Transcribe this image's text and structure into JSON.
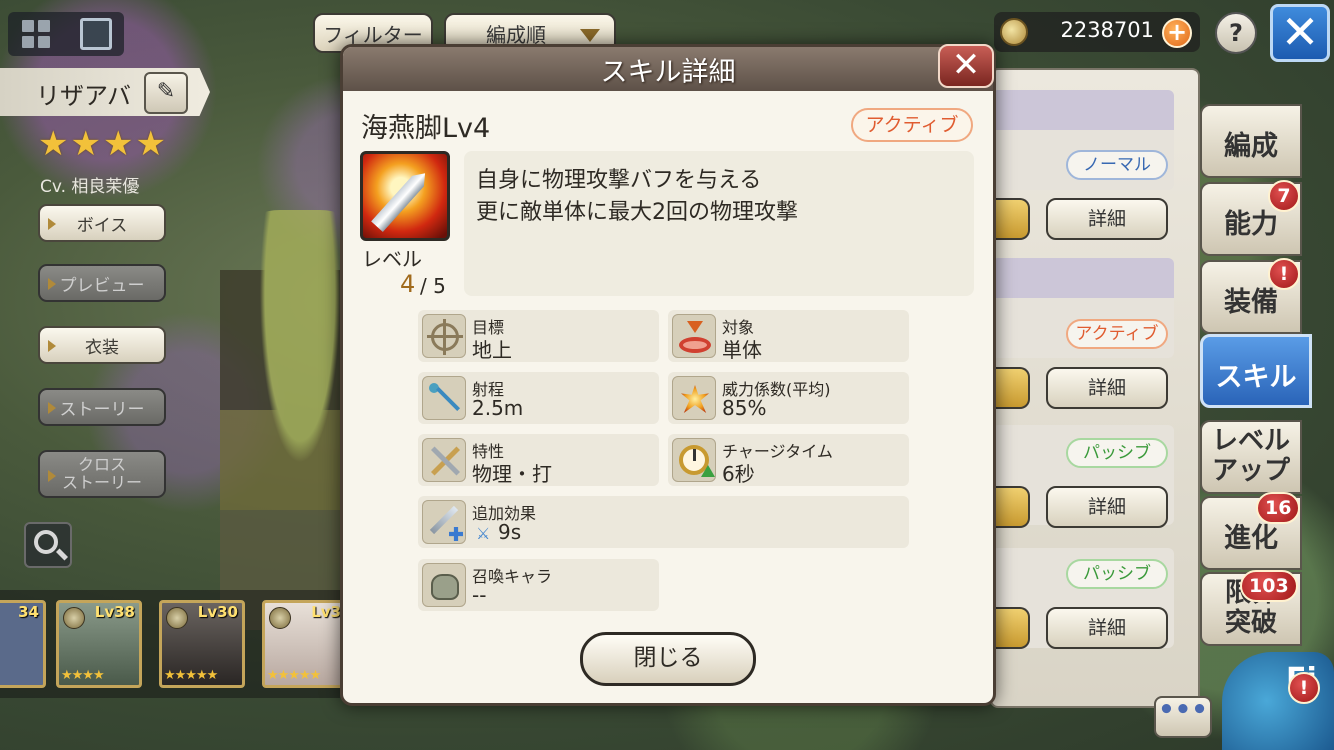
{
  "top_bar": {
    "filter_label": "フィルター",
    "sort_label": "編成順",
    "currency_value": "2238701",
    "help_label": "?",
    "close_label": "✕"
  },
  "character": {
    "name": "リザアバ",
    "stars": "★★★★",
    "cv": "Cv. 相良茉優"
  },
  "side_menu": [
    {
      "label": "ボイス"
    },
    {
      "label": "プレビュー"
    },
    {
      "label": "衣装"
    },
    {
      "label": "ストーリー"
    },
    {
      "label_line1": "クロス",
      "label_line2": "ストーリー"
    }
  ],
  "roster": [
    {
      "level": "34"
    },
    {
      "level": "Lv38",
      "stars": "★★★★"
    },
    {
      "level": "Lv30",
      "stars": "★★★★★"
    },
    {
      "level": "Lv3",
      "stars": "★★★★★"
    }
  ],
  "right_list": {
    "tags": [
      "ノーマル",
      "アクティブ",
      "パッシブ",
      "パッシブ"
    ],
    "detail_label": "詳細"
  },
  "tabs": [
    {
      "label": "編成"
    },
    {
      "label": "能力",
      "badge": "7"
    },
    {
      "label": "装備",
      "badge": "!"
    },
    {
      "label": "スキル"
    },
    {
      "label_line1": "レベル",
      "label_line2": "アップ"
    },
    {
      "label": "進化",
      "badge": "16"
    },
    {
      "label_line1": "限界",
      "label_line2": "突破",
      "badge": "103"
    }
  ],
  "chat_label": "•••",
  "mascot": {
    "text": "Fi",
    "badge": "!"
  },
  "dialog": {
    "title": "スキル詳細",
    "close_label": "✕",
    "skill_name": "海燕脚Lv4",
    "type_label": "アクティブ",
    "level_label": "レベル",
    "level_current": "4",
    "level_max": "/ 5",
    "description": [
      "自身に物理攻撃バフを与える",
      "更に敵単体に最大2回の物理攻撃"
    ],
    "stats": {
      "target": {
        "label": "目標",
        "value": "地上",
        "icon": "crosshair-icon"
      },
      "object": {
        "label": "対象",
        "value": "単体",
        "icon": "single-target-icon"
      },
      "range": {
        "label": "射程",
        "value": "2.5m",
        "icon": "arrow-range-icon"
      },
      "power": {
        "label": "威力係数(平均)",
        "value": "85%",
        "icon": "burst-icon"
      },
      "attribute": {
        "label": "特性",
        "value": "物理・打",
        "icon": "crossed-swords-icon"
      },
      "charge": {
        "label": "チャージタイム",
        "value": "6秒",
        "icon": "clock-icon"
      },
      "effect": {
        "label": "追加効果",
        "value": "9s",
        "icon": "sword-plus-icon"
      },
      "summon": {
        "label": "召喚キャラ",
        "value": "--",
        "icon": "summon-icon"
      }
    },
    "close_button": "閉じる"
  }
}
